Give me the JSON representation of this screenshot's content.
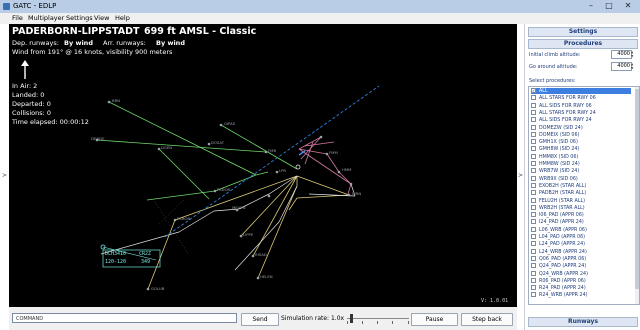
{
  "window": {
    "title": "GATC - EDLP",
    "minimize": "–",
    "maximize": "□",
    "close": "✕"
  },
  "menu": [
    "File",
    "Multiplayer",
    "Settings",
    "View",
    "Help"
  ],
  "hud": {
    "airport": "PADERBORN-LIPPSTADT",
    "elevation": "699 ft AMSL - Classic",
    "dep_prefix": "Dep. runways:",
    "dep_value": "By wind",
    "arr_prefix": "Arr. runways:",
    "arr_value": "By wind",
    "wind": "Wind from 191° @ 16 knots, visibility 900 meters",
    "in_air": "In Air: 2",
    "landed": "Landed: 0",
    "departed": "Departed: 0",
    "collisions": "Collisions: 0",
    "time_elapsed": "Time elapsed: 00:00:12",
    "version": "V: 1.0.01",
    "wind_arrow_icon": "wind-arrow-icon"
  },
  "aircraft": [
    {
      "callsign": "DLH3410",
      "dest": "CR2Z",
      "alt": "120-120",
      "speed": "349"
    }
  ],
  "radar_labels": [
    "BRN",
    "GIPAS",
    "DENDE",
    "DOSAT",
    "EXBON",
    "GOLUB",
    "HMM",
    "HELEN",
    "LIPPE",
    "MEVEN",
    "PADOR",
    "RISAD",
    "WRN",
    "LPR",
    "FMB",
    "FMM",
    "DGEN"
  ],
  "colors": {
    "radar_bg": "#000000",
    "route_green": "#7fe07a",
    "route_yellow": "#e6d27a",
    "route_pink": "#d87ca8",
    "runway_blue": "#2f7fd8",
    "label_gray": "#9aa0a8",
    "aircraft_cyan": "#76e8e0"
  },
  "panel": {
    "settings_header": "Settings",
    "procedures_header": "Procedures",
    "initial_climb_label": "Initial climb altitude:",
    "initial_climb_value": "4000",
    "go_around_label": "Go around altitude:",
    "go_around_value": "4000",
    "select_procedures_label": "Select procedures:",
    "runways_header": "Runways",
    "procedures": [
      {
        "label": "ALL",
        "checked": true,
        "selected": true
      },
      {
        "label": "ALL STARS FOR RWY 06",
        "checked": false
      },
      {
        "label": "ALL SIDS FOR RWY 06",
        "checked": false
      },
      {
        "label": "ALL STARS FOR RWY 24",
        "checked": false
      },
      {
        "label": "ALL SIDS FOR RWY 24",
        "checked": false
      },
      {
        "label": "DOMEZW (SID 24)",
        "checked": false
      },
      {
        "label": "DOMEIX (SID 06)",
        "checked": false
      },
      {
        "label": "GMH1X (SID 06)",
        "checked": false
      },
      {
        "label": "GMH8W (SID 24)",
        "checked": false
      },
      {
        "label": "HMM8X (SID 06)",
        "checked": false
      },
      {
        "label": "HMM8W (SID 24)",
        "checked": false
      },
      {
        "label": "WRB7W (SID 24)",
        "checked": false
      },
      {
        "label": "WRB9X (SID 06)",
        "checked": false
      },
      {
        "label": "EXOB2H (STAR ALL)",
        "checked": false
      },
      {
        "label": "PADB2H (STAR ALL)",
        "checked": false
      },
      {
        "label": "FELU2H (STAR ALL)",
        "checked": false
      },
      {
        "label": "WRB2H (STAR ALL)",
        "checked": false
      },
      {
        "label": "I06_PAD (APPR 06)",
        "checked": false
      },
      {
        "label": "I24_PAD (APPR 24)",
        "checked": false
      },
      {
        "label": "L06_WRB (APPR 06)",
        "checked": false
      },
      {
        "label": "L04_PAD (APPR 06)",
        "checked": false
      },
      {
        "label": "L24_PAD (APPR 24)",
        "checked": false
      },
      {
        "label": "L24_WRB (APPR 24)",
        "checked": false
      },
      {
        "label": "Q06_PAD (APPR 06)",
        "checked": false
      },
      {
        "label": "Q24_PAD (APPR 24)",
        "checked": false
      },
      {
        "label": "Q24_WRB (APPR 24)",
        "checked": false
      },
      {
        "label": "R06_PAD (APPR 06)",
        "checked": false
      },
      {
        "label": "R24_PAD (APPR 24)",
        "checked": false
      },
      {
        "label": "R24_WRB (APPR 24)",
        "checked": false
      }
    ]
  },
  "bottom": {
    "command_value": "COMMAND",
    "send_label": "Send",
    "sim_rate_label": "Simulation rate: 1.0x",
    "simulation_rate": 1.0,
    "pause_label": "Pause",
    "step_back_label": "Step back"
  },
  "side_arrows": {
    "left": ">",
    "right": ">"
  }
}
